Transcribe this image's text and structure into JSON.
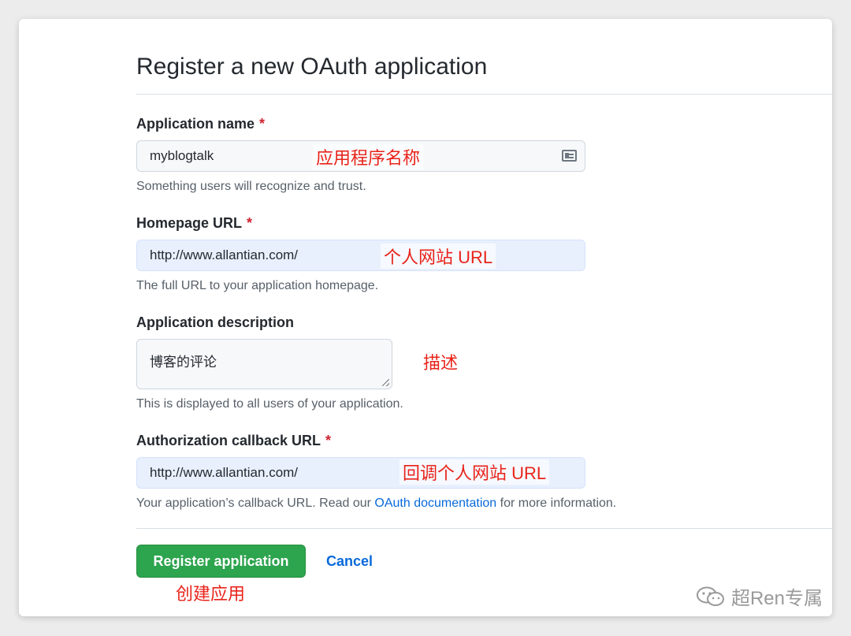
{
  "page": {
    "title": "Register a new OAuth application"
  },
  "fields": {
    "app_name": {
      "label": "Application name",
      "required_mark": "*",
      "value": "myblogtalk",
      "help": "Something users will recognize and trust.",
      "annotation": "应用程序名称"
    },
    "homepage": {
      "label": "Homepage URL",
      "required_mark": "*",
      "value": "http://www.allantian.com/",
      "help": "The full URL to your application homepage.",
      "annotation": "个人网站 URL"
    },
    "description": {
      "label": "Application description",
      "value": "博客的评论",
      "help": "This is displayed to all users of your application.",
      "annotation": "描述"
    },
    "callback": {
      "label": "Authorization callback URL",
      "required_mark": "*",
      "value": "http://www.allantian.com/",
      "help_before": "Your application’s callback URL. Read our",
      "help_link": "OAuth documentation",
      "help_after": "for more information.",
      "annotation": "回调个人网站 URL"
    }
  },
  "actions": {
    "register_label": "Register application",
    "cancel_label": "Cancel",
    "annotation": "创建应用"
  },
  "watermark": {
    "text": "超Ren专属"
  },
  "colors": {
    "primary_button": "#2da44e",
    "link": "#0969da",
    "annotation": "#e8231a",
    "required": "#cf222e"
  }
}
